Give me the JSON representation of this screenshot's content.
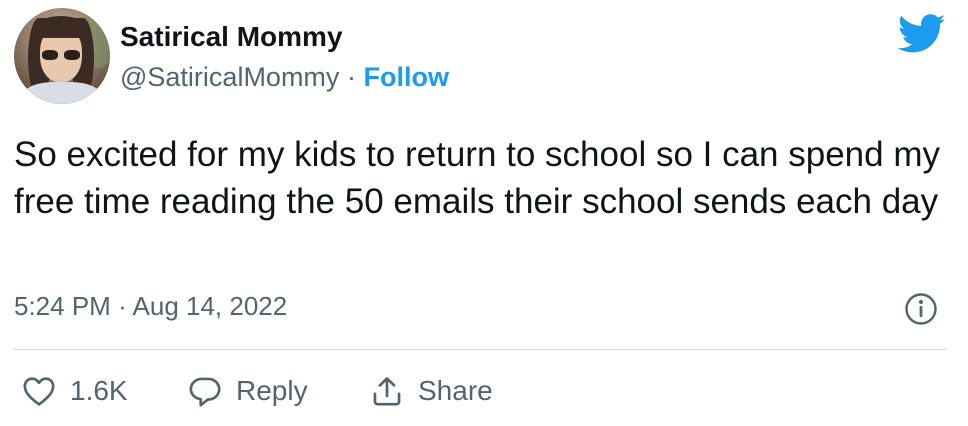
{
  "user": {
    "name": "Satirical Mommy",
    "handle": "@SatiricalMommy",
    "separator": "·",
    "follow_label": "Follow"
  },
  "tweet": {
    "text": "So excited for my kids to return to school so I can spend my free time reading the 50 emails their school sends each day",
    "time": "5:24 PM",
    "date": "Aug 14, 2022"
  },
  "actions": {
    "like_count": "1.6K",
    "reply_label": "Reply",
    "share_label": "Share"
  },
  "icons": {
    "brand": "twitter-bird-icon",
    "info": "info-icon",
    "like": "heart-icon",
    "reply": "speech-bubble-icon",
    "share": "share-arrow-icon"
  },
  "colors": {
    "brand_blue": "#1d9bf0",
    "text_primary": "#0f1419",
    "text_secondary": "#536471",
    "divider": "#cfd9de"
  }
}
